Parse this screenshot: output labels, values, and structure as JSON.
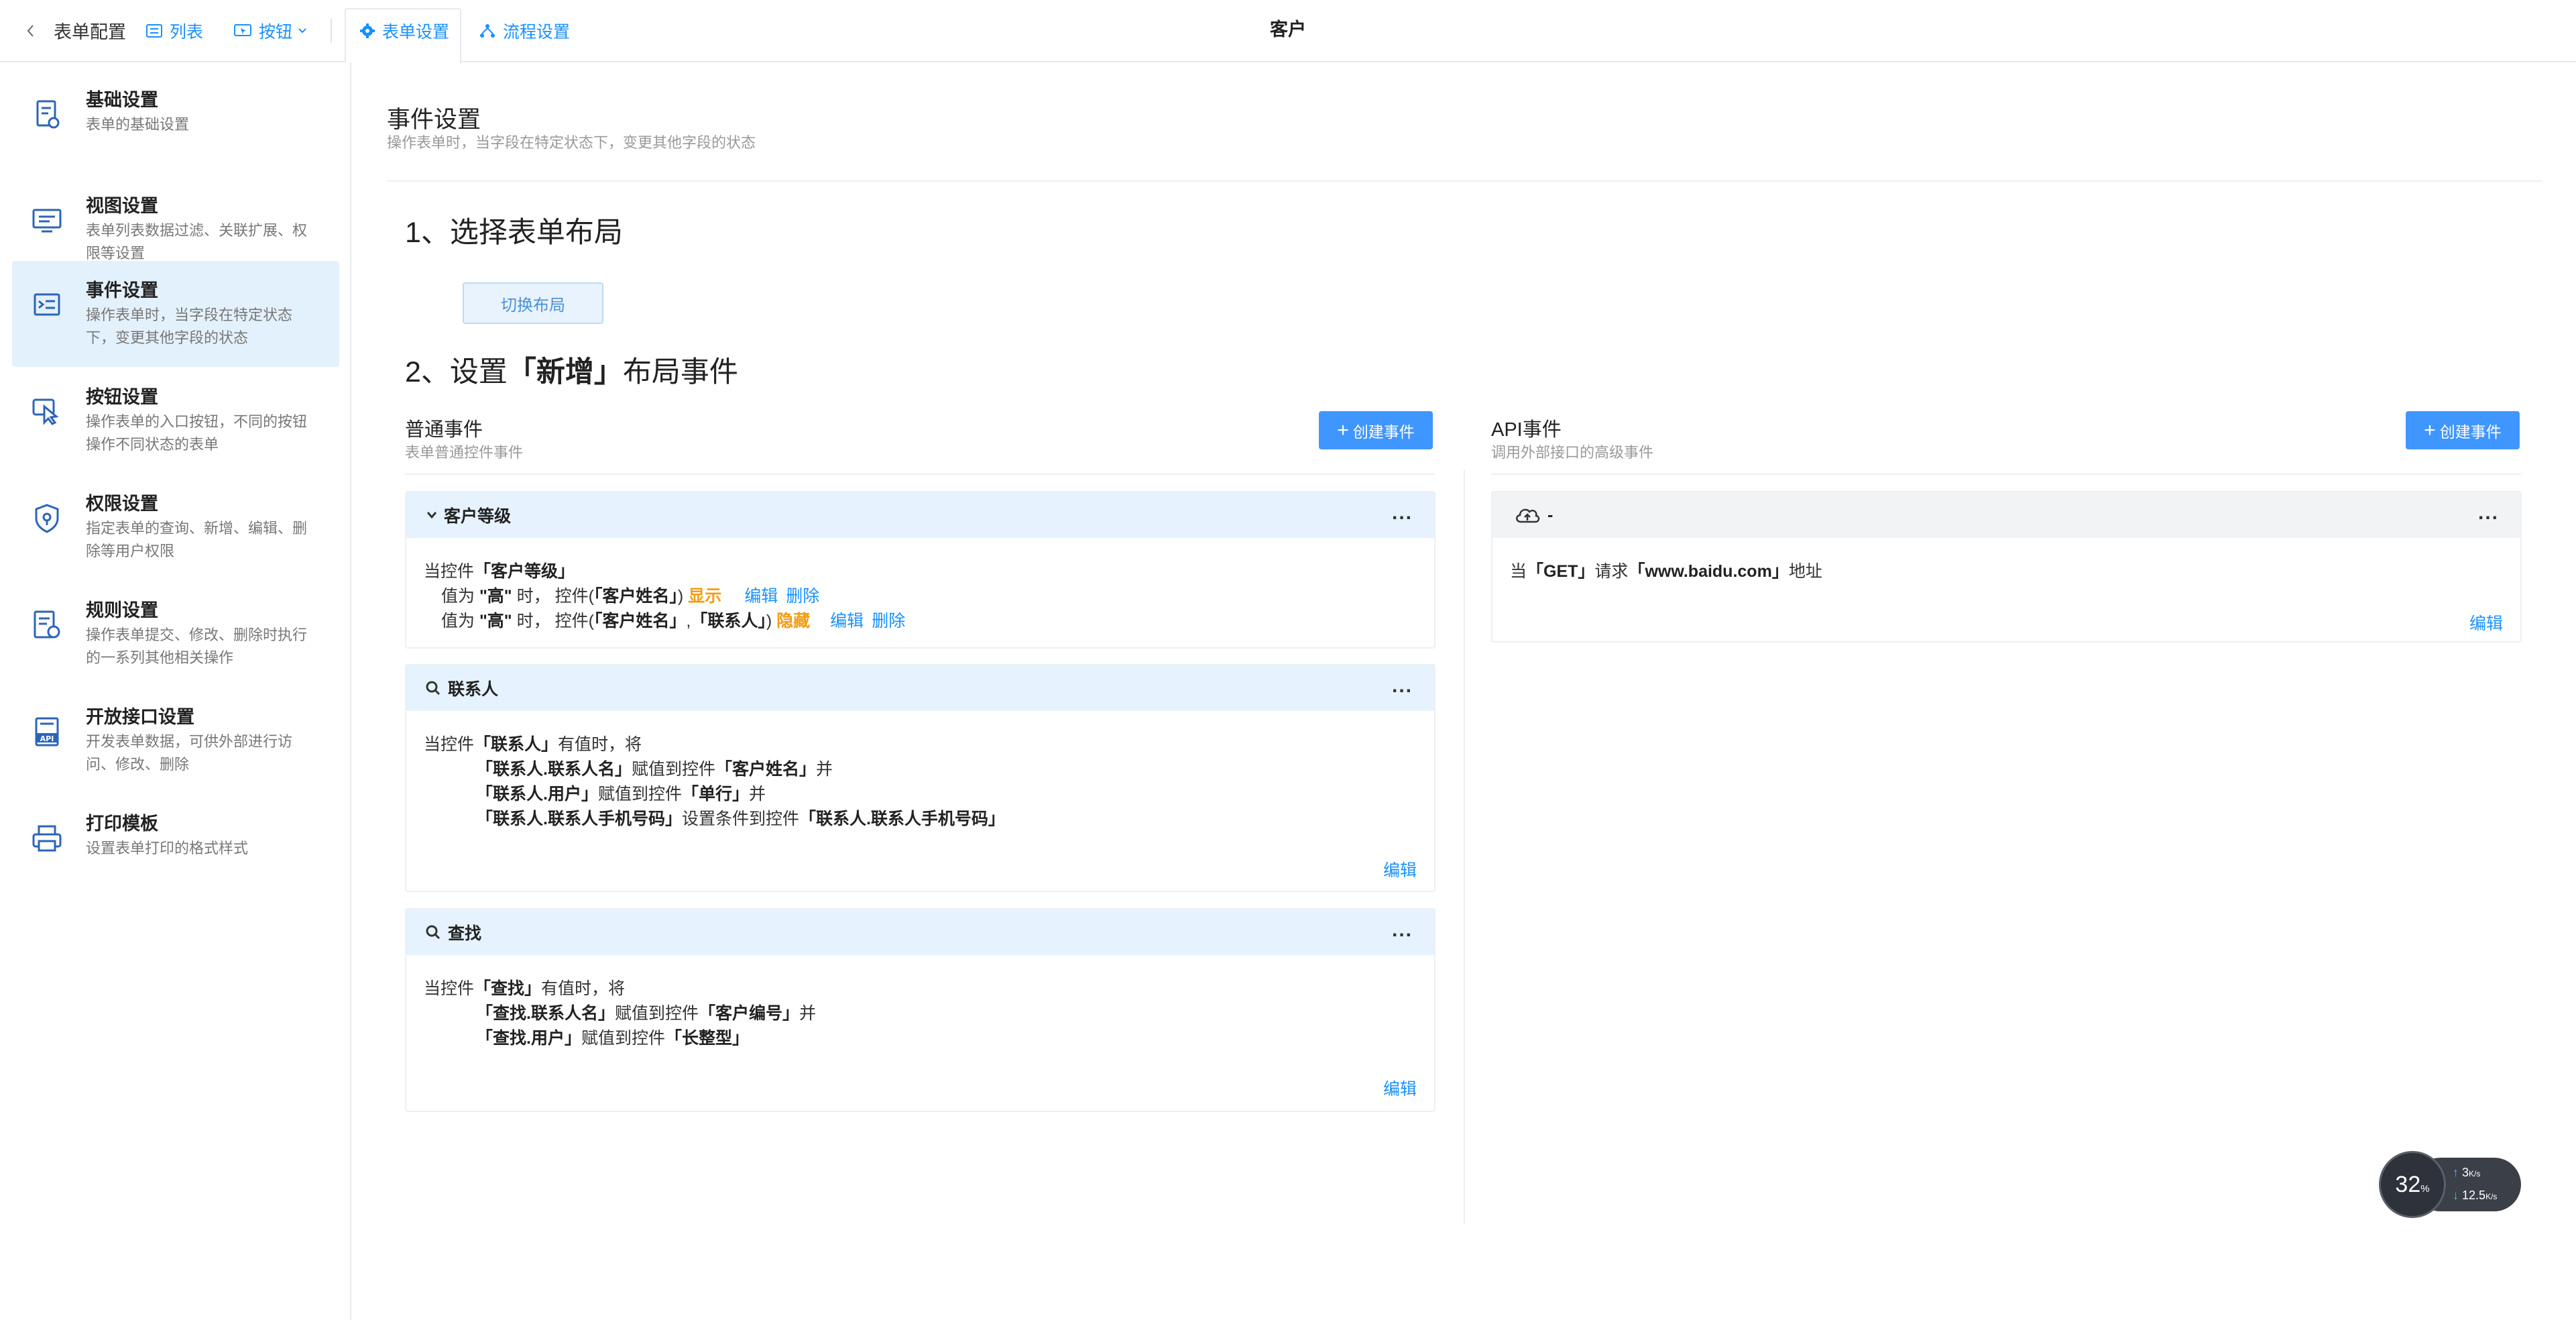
{
  "topbar": {
    "back_label": "表单配置",
    "list_label": "列表",
    "button_label": "按钮",
    "form_settings_label": "表单设置",
    "flow_settings_label": "流程设置",
    "title": "客户"
  },
  "sidebar": {
    "items": [
      {
        "title": "基础设置",
        "desc": "表单的基础设置",
        "icon": "form-doc-icon"
      },
      {
        "title": "视图设置",
        "desc": "表单列表数据过滤、关联扩展、权限等设置",
        "icon": "monitor-icon"
      },
      {
        "title": "事件设置",
        "desc": "操作表单时，当字段在特定状态下，变更其他字段的状态",
        "icon": "event-icon"
      },
      {
        "title": "按钮设置",
        "desc": "操作表单的入口按钮，不同的按钮操作不同状态的表单",
        "icon": "pointer-icon"
      },
      {
        "title": "权限设置",
        "desc": "指定表单的查询、新增、编辑、删除等用户权限",
        "icon": "shield-icon"
      },
      {
        "title": "规则设置",
        "desc": "操作表单提交、修改、删除时执行的一系列其他相关操作",
        "icon": "rules-icon"
      },
      {
        "title": "开放接口设置",
        "desc": "开发表单数据，可供外部进行访问、修改、删除",
        "icon": "api-icon"
      },
      {
        "title": "打印模板",
        "desc": "设置表单打印的格式样式",
        "icon": "printer-icon"
      }
    ],
    "active_index": 2
  },
  "main": {
    "title": "事件设置",
    "subtitle": "操作表单时，当字段在特定状态下，变更其他字段的状态",
    "step1": "1、选择表单布局",
    "switch_layout": "切换布局",
    "step2_prefix": "2、设置",
    "step2_bold": "「新增」",
    "step2_suffix": "布局事件",
    "normal": {
      "title": "普通事件",
      "subtitle": "表单普通控件事件",
      "create_label": "创建事件",
      "cards": [
        {
          "name": "客户等级",
          "icon": "chevron-down-icon",
          "lines": [
            {
              "t1": "当控件",
              "b1": "「客户等级」"
            },
            {
              "t1": "值为 ",
              "b1": "\"高\"",
              "t2": " 时，  控件(",
              "b2": "「客户姓名」",
              "t3": ") ",
              "status": "显示",
              "edit": "编辑",
              "delete": "删除"
            },
            {
              "t1": "值为 ",
              "b1": "\"高\"",
              "t2": " 时，  控件(",
              "b2": "「客户姓名」",
              "t3": ",",
              "b3": "「联系人」",
              "t4": ") ",
              "status": "隐藏",
              "edit": "编辑",
              "delete": "删除"
            }
          ]
        },
        {
          "name": "联系人",
          "icon": "search-icon",
          "lines": [
            {
              "t1": "当控件",
              "b1": "「联系人」",
              "t2": "有值时，将"
            },
            {
              "b1": "「联系人.联系人名」",
              "t2": "赋值到控件",
              "b2": "「客户姓名」",
              "t3": "并"
            },
            {
              "b1": "「联系人.用户」",
              "t2": "赋值到控件",
              "b2": "「单行」",
              "t3": "并"
            },
            {
              "b1": "「联系人.联系人手机号码」",
              "t2": "设置条件到控件",
              "b2": "「联系人.联系人手机号码」"
            }
          ],
          "edit": "编辑"
        },
        {
          "name": "查找",
          "icon": "search-icon",
          "lines": [
            {
              "t1": "当控件",
              "b1": "「查找」",
              "t2": "有值时，将"
            },
            {
              "b1": "「查找.联系人名」",
              "t2": "赋值到控件",
              "b2": "「客户编号」",
              "t3": "并"
            },
            {
              "b1": "「查找.用户」",
              "t2": "赋值到控件",
              "b2": "「长整型」"
            }
          ],
          "edit": "编辑"
        }
      ]
    },
    "api": {
      "title": "API事件",
      "subtitle": "调用外部接口的高级事件",
      "create_label": "创建事件",
      "card": {
        "name": "-",
        "icon": "cloud-icon",
        "text_a": "当",
        "text_b": "「GET」",
        "text_c": "请求",
        "text_d": "「www.baidu.com」",
        "text_e": "地址",
        "edit": "编辑"
      }
    },
    "more_label": "..."
  },
  "network_widget": {
    "percent": "32",
    "percent_unit": "%",
    "upload": "3",
    "upload_unit": "K/s",
    "download": "12.5",
    "download_unit": "K/s"
  },
  "colors": {
    "accent": "#1890ff",
    "button": "#4096ff",
    "active_bg": "#e3f1fd",
    "status_orange": "#f39c12"
  }
}
